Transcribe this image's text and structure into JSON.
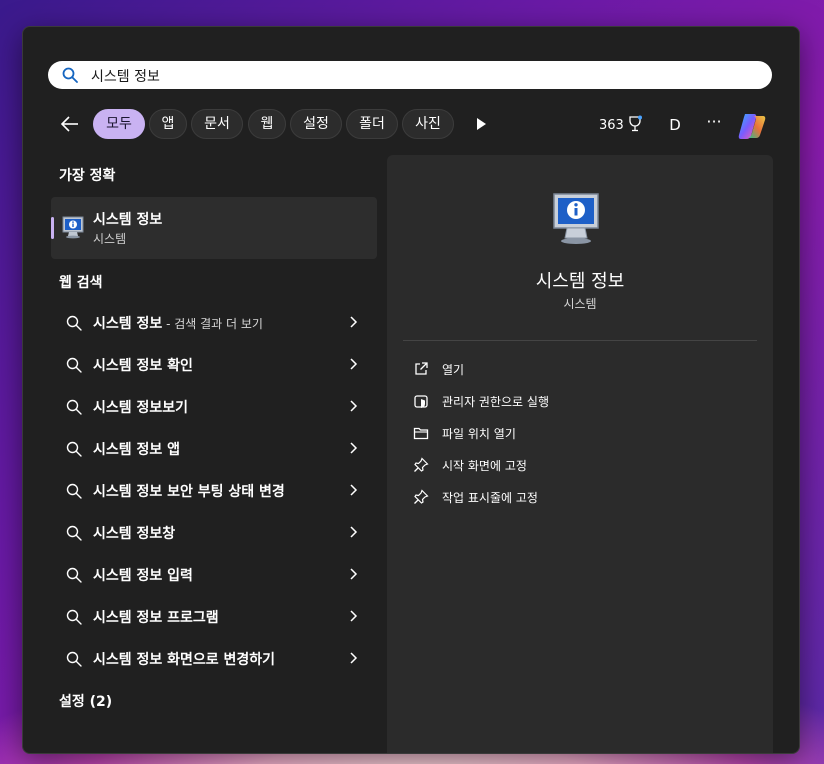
{
  "search": {
    "value": "시스템 정보"
  },
  "filters": [
    {
      "label": "모두",
      "active": true
    },
    {
      "label": "앱"
    },
    {
      "label": "문서"
    },
    {
      "label": "웹"
    },
    {
      "label": "설정"
    },
    {
      "label": "폴더"
    },
    {
      "label": "사진"
    }
  ],
  "header": {
    "points": "363",
    "avatar_letter": "D",
    "more": "···"
  },
  "best_match": {
    "heading": "가장 정확",
    "title": "시스템 정보",
    "subtitle": "시스템"
  },
  "web_search": {
    "heading": "웹 검색",
    "items": [
      {
        "label": "시스템 정보",
        "suffix": " - 검색 결과 더 보기"
      },
      {
        "label": "시스템 정보 확인"
      },
      {
        "label": "시스템 정보보기"
      },
      {
        "label": "시스템 정보 앱"
      },
      {
        "label": "시스템 정보 보안 부팅 상태 변경"
      },
      {
        "label": "시스템 정보창"
      },
      {
        "label": "시스템 정보 입력"
      },
      {
        "label": "시스템 정보 프로그램"
      },
      {
        "label": "시스템 정보 화면으로 변경하기"
      }
    ]
  },
  "settings_heading": "설정 (2)",
  "detail": {
    "title": "시스템 정보",
    "subtitle": "시스템",
    "actions": [
      {
        "label": "열기",
        "icon": "open-external-icon"
      },
      {
        "label": "관리자 권한으로 실행",
        "icon": "shield-admin-icon"
      },
      {
        "label": "파일 위치 열기",
        "icon": "folder-icon"
      },
      {
        "label": "시작 화면에 고정",
        "icon": "pin-icon"
      },
      {
        "label": "작업 표시줄에 고정",
        "icon": "pin-icon"
      }
    ]
  },
  "colors": {
    "accent": "#c9b2f2",
    "panel": "#202020",
    "detail_panel": "#2b2b2b"
  }
}
